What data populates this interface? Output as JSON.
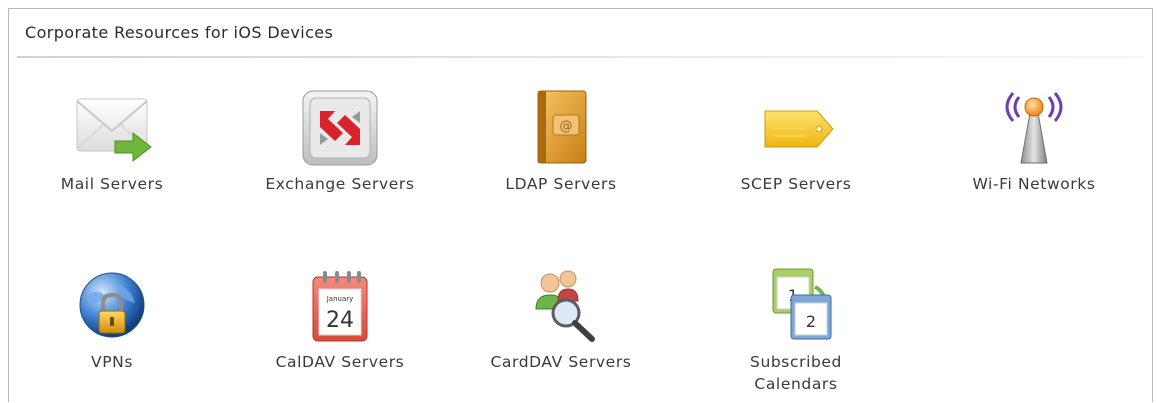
{
  "panel": {
    "title": "Corporate Resources for iOS Devices"
  },
  "resources": [
    {
      "label": "Mail Servers",
      "icon": "mail-server-icon"
    },
    {
      "label": "Exchange Servers",
      "icon": "exchange-server-icon"
    },
    {
      "label": "LDAP Servers",
      "icon": "ldap-address-book-icon"
    },
    {
      "label": "SCEP Servers",
      "icon": "scep-tag-icon"
    },
    {
      "label": "Wi-Fi Networks",
      "icon": "wifi-antenna-icon"
    },
    {
      "label": "VPNs",
      "icon": "vpn-globe-lock-icon"
    },
    {
      "label": "CalDAV Servers",
      "icon": "caldav-calendar-icon",
      "calendar_month": "January",
      "calendar_day": "24"
    },
    {
      "label": "CardDAV Servers",
      "icon": "carddav-contacts-search-icon"
    },
    {
      "label_line1": "Subscribed",
      "label_line2": "Calendars",
      "icon": "subscribed-calendars-icon",
      "calendar_day_1": "1",
      "calendar_day_2": "2"
    }
  ]
}
